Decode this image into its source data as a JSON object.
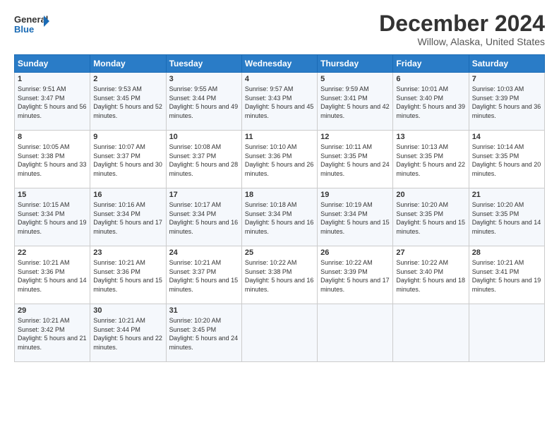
{
  "header": {
    "logo_line1": "General",
    "logo_line2": "Blue",
    "month_title": "December 2024",
    "location": "Willow, Alaska, United States"
  },
  "days_of_week": [
    "Sunday",
    "Monday",
    "Tuesday",
    "Wednesday",
    "Thursday",
    "Friday",
    "Saturday"
  ],
  "weeks": [
    [
      {
        "day": "1",
        "sunrise": "Sunrise: 9:51 AM",
        "sunset": "Sunset: 3:47 PM",
        "daylight": "Daylight: 5 hours and 56 minutes."
      },
      {
        "day": "2",
        "sunrise": "Sunrise: 9:53 AM",
        "sunset": "Sunset: 3:45 PM",
        "daylight": "Daylight: 5 hours and 52 minutes."
      },
      {
        "day": "3",
        "sunrise": "Sunrise: 9:55 AM",
        "sunset": "Sunset: 3:44 PM",
        "daylight": "Daylight: 5 hours and 49 minutes."
      },
      {
        "day": "4",
        "sunrise": "Sunrise: 9:57 AM",
        "sunset": "Sunset: 3:43 PM",
        "daylight": "Daylight: 5 hours and 45 minutes."
      },
      {
        "day": "5",
        "sunrise": "Sunrise: 9:59 AM",
        "sunset": "Sunset: 3:41 PM",
        "daylight": "Daylight: 5 hours and 42 minutes."
      },
      {
        "day": "6",
        "sunrise": "Sunrise: 10:01 AM",
        "sunset": "Sunset: 3:40 PM",
        "daylight": "Daylight: 5 hours and 39 minutes."
      },
      {
        "day": "7",
        "sunrise": "Sunrise: 10:03 AM",
        "sunset": "Sunset: 3:39 PM",
        "daylight": "Daylight: 5 hours and 36 minutes."
      }
    ],
    [
      {
        "day": "8",
        "sunrise": "Sunrise: 10:05 AM",
        "sunset": "Sunset: 3:38 PM",
        "daylight": "Daylight: 5 hours and 33 minutes."
      },
      {
        "day": "9",
        "sunrise": "Sunrise: 10:07 AM",
        "sunset": "Sunset: 3:37 PM",
        "daylight": "Daylight: 5 hours and 30 minutes."
      },
      {
        "day": "10",
        "sunrise": "Sunrise: 10:08 AM",
        "sunset": "Sunset: 3:37 PM",
        "daylight": "Daylight: 5 hours and 28 minutes."
      },
      {
        "day": "11",
        "sunrise": "Sunrise: 10:10 AM",
        "sunset": "Sunset: 3:36 PM",
        "daylight": "Daylight: 5 hours and 26 minutes."
      },
      {
        "day": "12",
        "sunrise": "Sunrise: 10:11 AM",
        "sunset": "Sunset: 3:35 PM",
        "daylight": "Daylight: 5 hours and 24 minutes."
      },
      {
        "day": "13",
        "sunrise": "Sunrise: 10:13 AM",
        "sunset": "Sunset: 3:35 PM",
        "daylight": "Daylight: 5 hours and 22 minutes."
      },
      {
        "day": "14",
        "sunrise": "Sunrise: 10:14 AM",
        "sunset": "Sunset: 3:35 PM",
        "daylight": "Daylight: 5 hours and 20 minutes."
      }
    ],
    [
      {
        "day": "15",
        "sunrise": "Sunrise: 10:15 AM",
        "sunset": "Sunset: 3:34 PM",
        "daylight": "Daylight: 5 hours and 19 minutes."
      },
      {
        "day": "16",
        "sunrise": "Sunrise: 10:16 AM",
        "sunset": "Sunset: 3:34 PM",
        "daylight": "Daylight: 5 hours and 17 minutes."
      },
      {
        "day": "17",
        "sunrise": "Sunrise: 10:17 AM",
        "sunset": "Sunset: 3:34 PM",
        "daylight": "Daylight: 5 hours and 16 minutes."
      },
      {
        "day": "18",
        "sunrise": "Sunrise: 10:18 AM",
        "sunset": "Sunset: 3:34 PM",
        "daylight": "Daylight: 5 hours and 16 minutes."
      },
      {
        "day": "19",
        "sunrise": "Sunrise: 10:19 AM",
        "sunset": "Sunset: 3:34 PM",
        "daylight": "Daylight: 5 hours and 15 minutes."
      },
      {
        "day": "20",
        "sunrise": "Sunrise: 10:20 AM",
        "sunset": "Sunset: 3:35 PM",
        "daylight": "Daylight: 5 hours and 15 minutes."
      },
      {
        "day": "21",
        "sunrise": "Sunrise: 10:20 AM",
        "sunset": "Sunset: 3:35 PM",
        "daylight": "Daylight: 5 hours and 14 minutes."
      }
    ],
    [
      {
        "day": "22",
        "sunrise": "Sunrise: 10:21 AM",
        "sunset": "Sunset: 3:36 PM",
        "daylight": "Daylight: 5 hours and 14 minutes."
      },
      {
        "day": "23",
        "sunrise": "Sunrise: 10:21 AM",
        "sunset": "Sunset: 3:36 PM",
        "daylight": "Daylight: 5 hours and 15 minutes."
      },
      {
        "day": "24",
        "sunrise": "Sunrise: 10:21 AM",
        "sunset": "Sunset: 3:37 PM",
        "daylight": "Daylight: 5 hours and 15 minutes."
      },
      {
        "day": "25",
        "sunrise": "Sunrise: 10:22 AM",
        "sunset": "Sunset: 3:38 PM",
        "daylight": "Daylight: 5 hours and 16 minutes."
      },
      {
        "day": "26",
        "sunrise": "Sunrise: 10:22 AM",
        "sunset": "Sunset: 3:39 PM",
        "daylight": "Daylight: 5 hours and 17 minutes."
      },
      {
        "day": "27",
        "sunrise": "Sunrise: 10:22 AM",
        "sunset": "Sunset: 3:40 PM",
        "daylight": "Daylight: 5 hours and 18 minutes."
      },
      {
        "day": "28",
        "sunrise": "Sunrise: 10:21 AM",
        "sunset": "Sunset: 3:41 PM",
        "daylight": "Daylight: 5 hours and 19 minutes."
      }
    ],
    [
      {
        "day": "29",
        "sunrise": "Sunrise: 10:21 AM",
        "sunset": "Sunset: 3:42 PM",
        "daylight": "Daylight: 5 hours and 21 minutes."
      },
      {
        "day": "30",
        "sunrise": "Sunrise: 10:21 AM",
        "sunset": "Sunset: 3:44 PM",
        "daylight": "Daylight: 5 hours and 22 minutes."
      },
      {
        "day": "31",
        "sunrise": "Sunrise: 10:20 AM",
        "sunset": "Sunset: 3:45 PM",
        "daylight": "Daylight: 5 hours and 24 minutes."
      },
      null,
      null,
      null,
      null
    ]
  ]
}
